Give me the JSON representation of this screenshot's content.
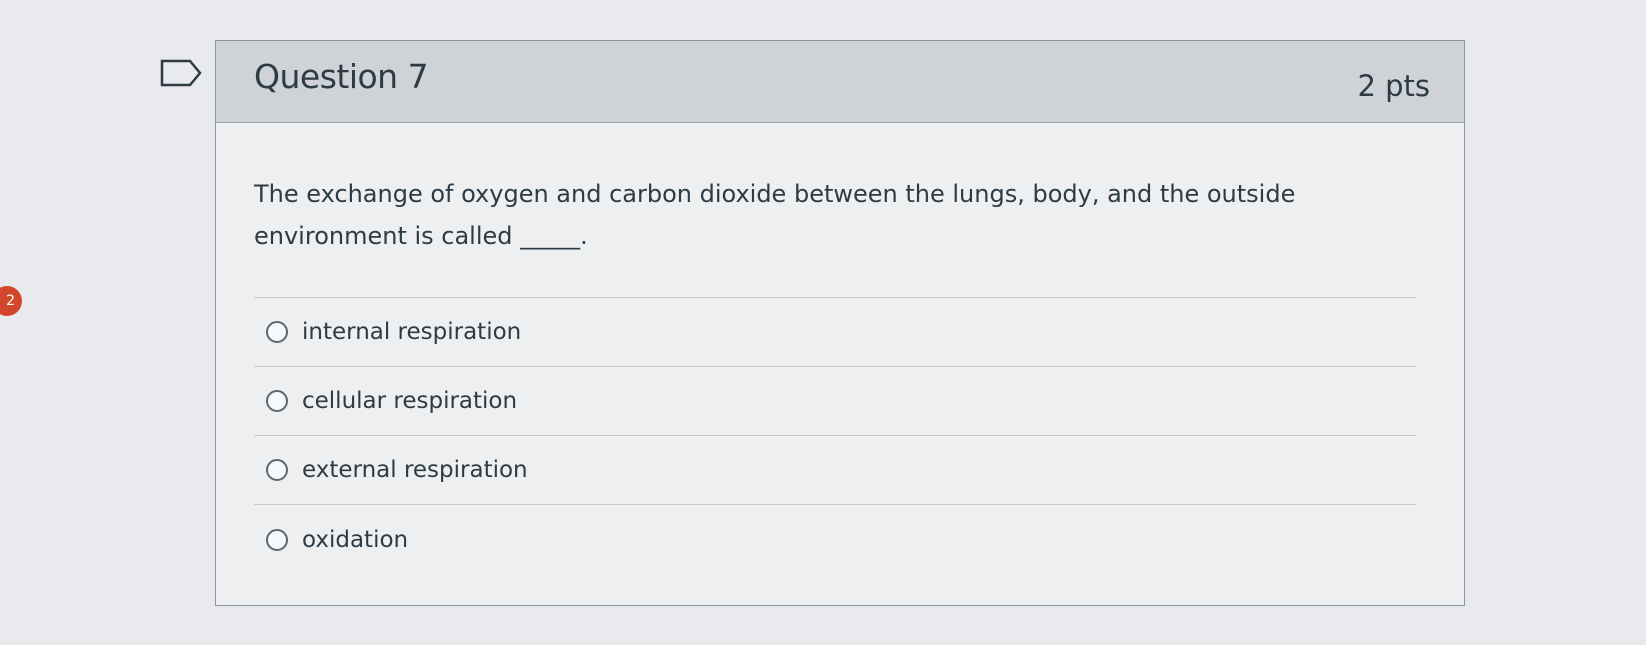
{
  "question": {
    "title": "Question 7",
    "points": "2 pts",
    "text": "The exchange of oxygen and carbon dioxide between the lungs, body, and the outside environment is called _____."
  },
  "answers": [
    {
      "label": "internal respiration"
    },
    {
      "label": "cellular respiration"
    },
    {
      "label": "external respiration"
    },
    {
      "label": "oxidation"
    }
  ],
  "side_badge": "2",
  "icons": {
    "flag": "flag-bookmark-icon",
    "radio": "radio-unselected-icon"
  },
  "colors": {
    "header_bg": "#cfd2d7",
    "text": "#2d3b45",
    "badge": "#d2472b"
  }
}
